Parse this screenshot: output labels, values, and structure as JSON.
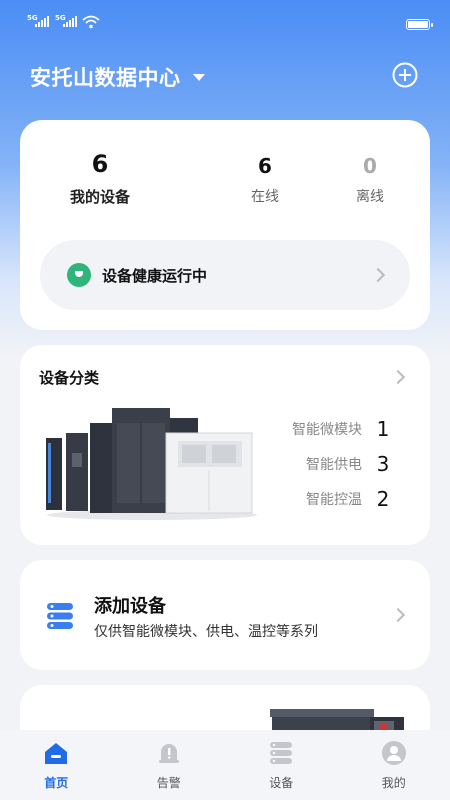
{
  "status_bar": {
    "signal1": "5G",
    "signal2": "5G"
  },
  "header": {
    "title": "安托山数据中心"
  },
  "summary": {
    "my_devices": {
      "value": "6",
      "label": "我的设备"
    },
    "online": {
      "value": "6",
      "label": "在线"
    },
    "offline": {
      "value": "0",
      "label": "离线"
    },
    "health_text": "设备健康运行中"
  },
  "category": {
    "title": "设备分类",
    "items": [
      {
        "label": "智能微模块",
        "count": "1"
      },
      {
        "label": "智能供电",
        "count": "3"
      },
      {
        "label": "智能控温",
        "count": "2"
      }
    ]
  },
  "add_device": {
    "title": "添加设备",
    "subtitle": "仅供智能微模块、供电、温控等系列"
  },
  "tabs": [
    {
      "label": "首页",
      "icon": "home-icon",
      "active": true
    },
    {
      "label": "告警",
      "icon": "bell-icon",
      "active": false
    },
    {
      "label": "设备",
      "icon": "server-icon",
      "active": false
    },
    {
      "label": "我的",
      "icon": "user-icon",
      "active": false
    }
  ],
  "colors": {
    "accent": "#1f6be8",
    "healthy": "#2fb57c",
    "gradient_top": "#4a8df5"
  }
}
